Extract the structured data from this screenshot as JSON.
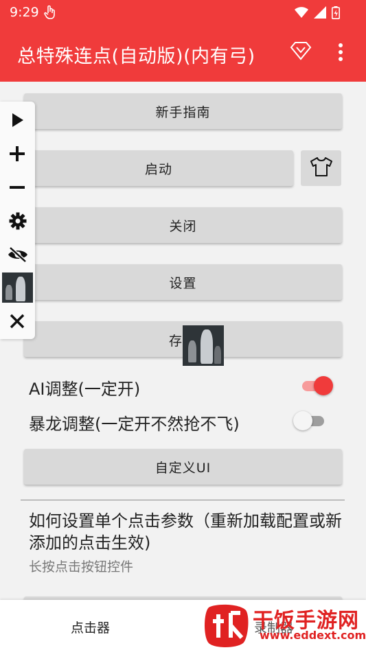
{
  "status_bar": {
    "time": "9:29"
  },
  "app_bar": {
    "title": "总特殊连点(自动版)(内有弓)"
  },
  "buttons": {
    "guide": "新手指南",
    "start": "启动",
    "close": "关闭",
    "settings": "设置",
    "save": "存"
  },
  "switches": {
    "ai_adjust": {
      "label": "AI调整(一定开)",
      "on": true
    },
    "dragon_adjust": {
      "label": "暴龙调整(一定开不然抢不飞)",
      "on": false
    }
  },
  "custom_ui_button": "自定义UI",
  "help": {
    "title": "如何设置单个点击参数（重新加载配置或新添加的点击生效)",
    "subtitle": "长按点击按钮控件"
  },
  "bottom_nav": {
    "tab_clicker": "点击器",
    "tab_record": "录制器"
  },
  "watermark": {
    "brand": "干饭手游网",
    "url": "www.eddext.com"
  },
  "colors": {
    "accent": "#f03b3b",
    "switch_on": "#f03b3b",
    "button_bg": "#d9d9d9"
  }
}
